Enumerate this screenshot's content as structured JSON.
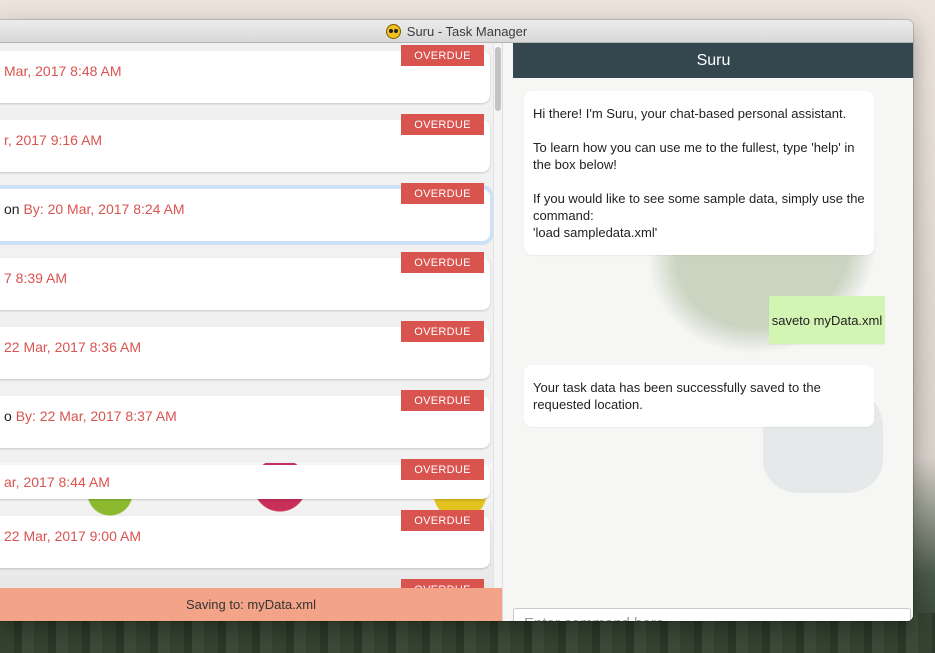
{
  "window": {
    "title": "Suru - Task Manager"
  },
  "tasks": [
    {
      "title": "",
      "due": "Mar, 2017 8:48 AM",
      "status": "OVERDUE"
    },
    {
      "title": "",
      "due": "r, 2017 9:16 AM",
      "status": "OVERDUE"
    },
    {
      "title": "on",
      "due": "By: 20 Mar, 2017 8:24 AM",
      "status": "OVERDUE",
      "selected": true
    },
    {
      "title": "",
      "due": "7 8:39 AM",
      "status": "OVERDUE"
    },
    {
      "title": "",
      "due": "22 Mar, 2017 8:36 AM",
      "status": "OVERDUE"
    },
    {
      "title": "o",
      "due": "By: 22 Mar, 2017 8:37 AM",
      "status": "OVERDUE"
    },
    {
      "title": "",
      "due": "ar, 2017 8:44 AM",
      "status": "OVERDUE"
    },
    {
      "title": "",
      "due": "22 Mar, 2017 9:00 AM",
      "status": "OVERDUE"
    },
    {
      "title": "",
      "due": "",
      "status": "OVERDUE"
    }
  ],
  "status_bar": {
    "text": "Saving to: myData.xml"
  },
  "chat": {
    "header": "Suru",
    "messages": [
      {
        "from": "bot",
        "text": "Hi there! I'm Suru, your chat-based personal assistant.\n\nTo learn how you can use me to the fullest, type 'help' in the box below!\n\nIf you would like to see some sample data, simply use the command:\n'load sampledata.xml'"
      },
      {
        "from": "user",
        "text": "saveto myData.xml"
      },
      {
        "from": "bot",
        "text": "Your task data has been successfully saved to the requested location."
      }
    ],
    "input": {
      "value": "",
      "placeholder": "Enter command here..."
    }
  },
  "colors": {
    "overdue": "#d9534f",
    "header": "#34474e",
    "user_bubble": "#d3f5b4",
    "status_bar": "#f3a488",
    "selected_outline": "#cde1f6"
  }
}
